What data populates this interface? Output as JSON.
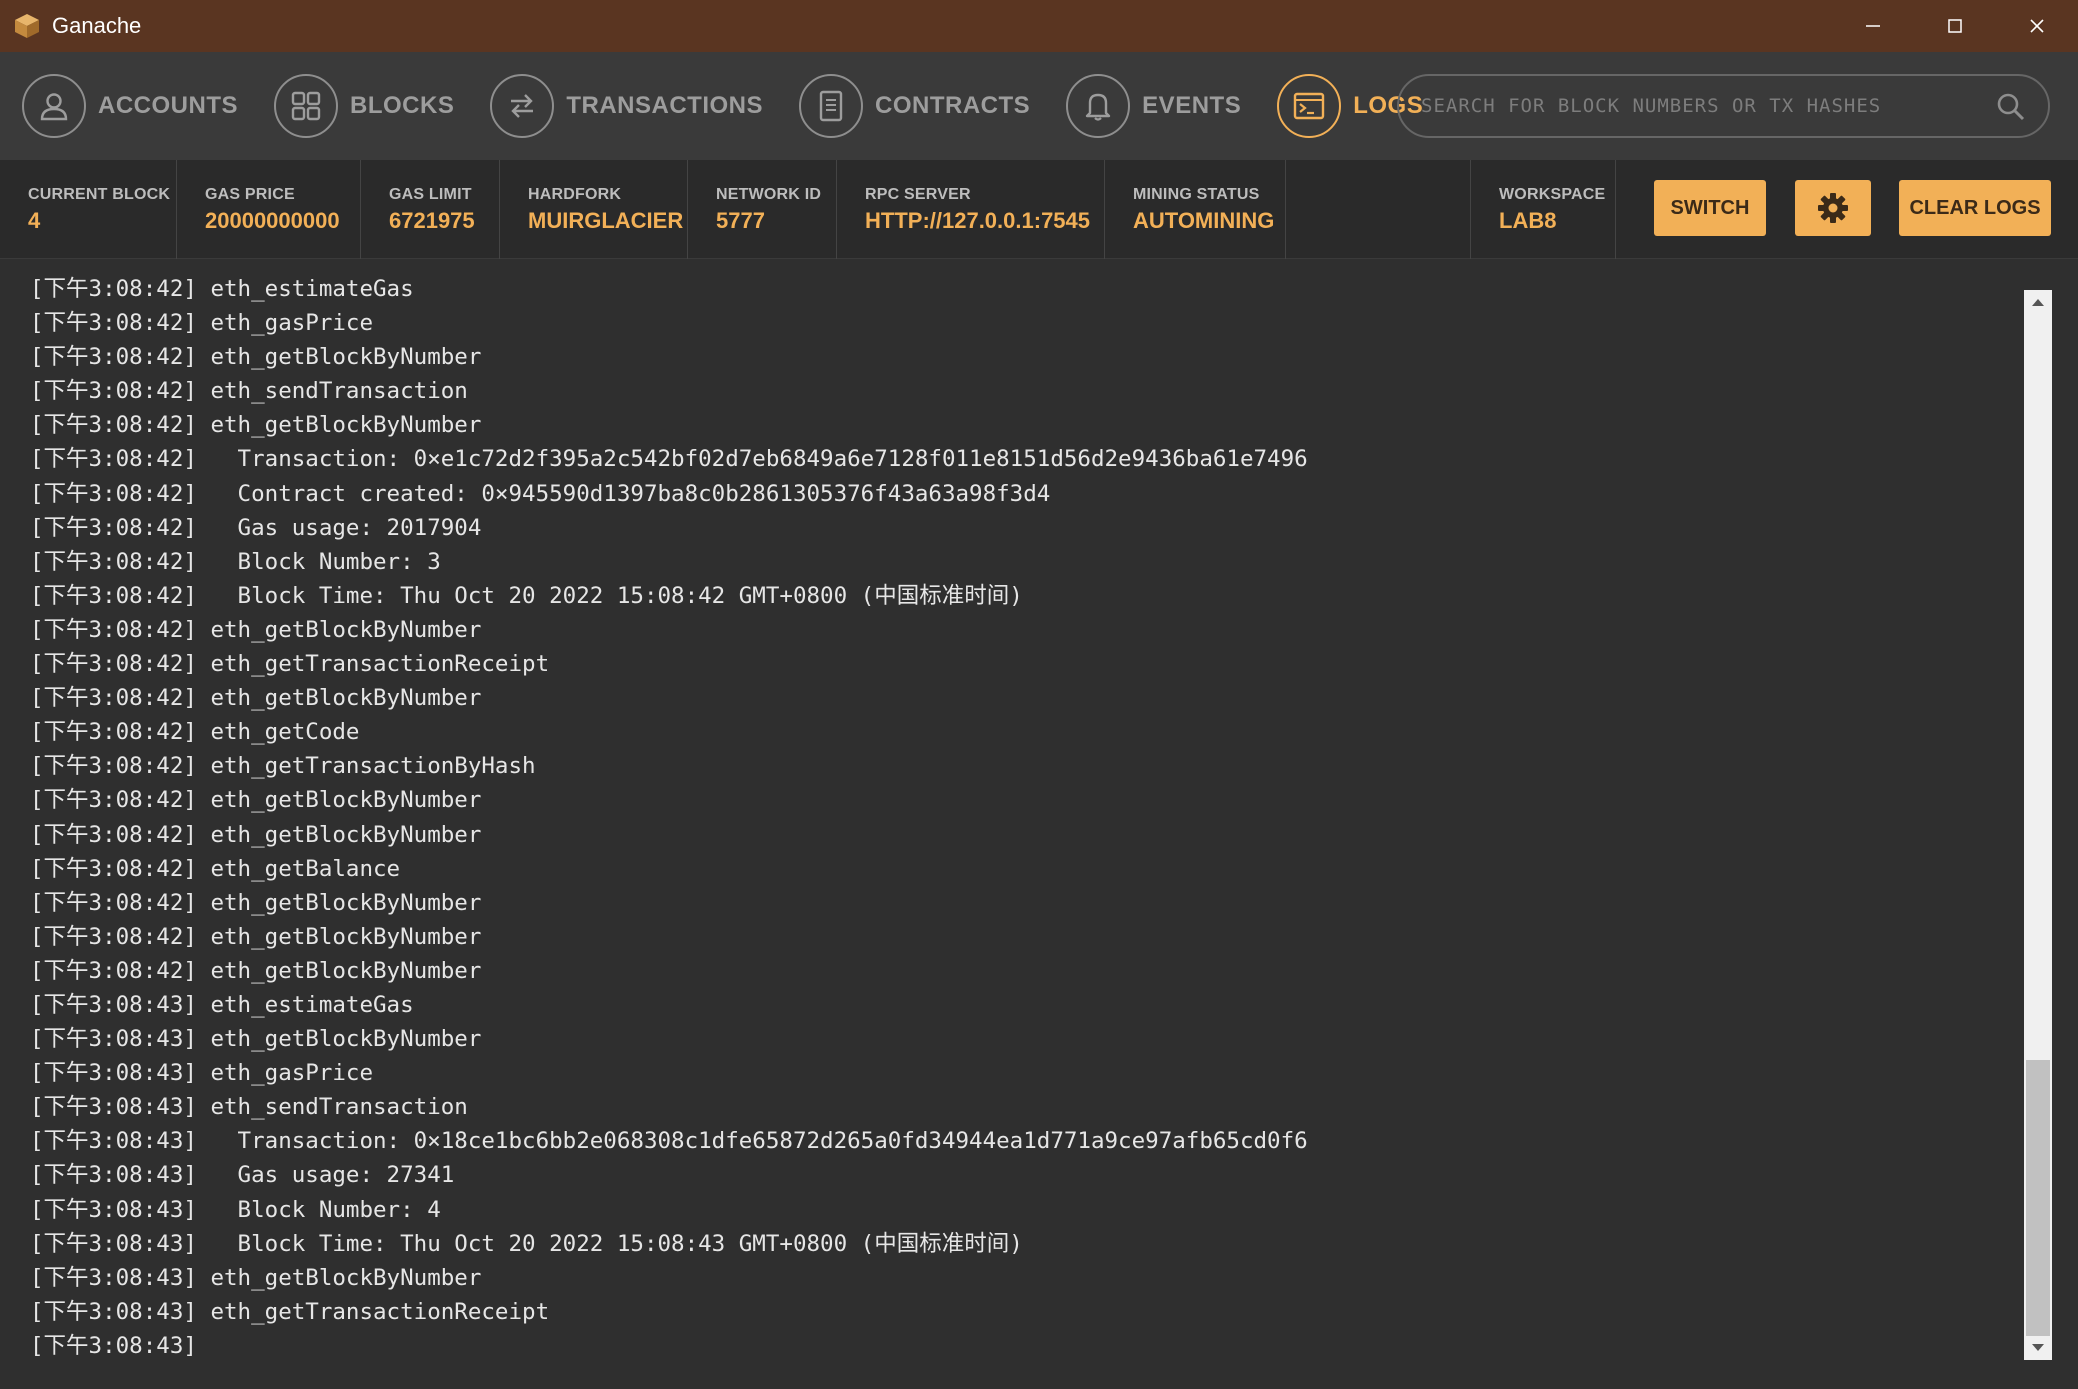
{
  "window": {
    "title": "Ganache",
    "controls": [
      "minimize-icon",
      "maximize-icon",
      "close-icon"
    ]
  },
  "nav": {
    "items": [
      {
        "label": "ACCOUNTS",
        "icon": "user-icon"
      },
      {
        "label": "BLOCKS",
        "icon": "grid-icon"
      },
      {
        "label": "TRANSACTIONS",
        "icon": "swap-arrows-icon"
      },
      {
        "label": "CONTRACTS",
        "icon": "document-icon"
      },
      {
        "label": "EVENTS",
        "icon": "bell-icon"
      },
      {
        "label": "LOGS",
        "icon": "terminal-icon"
      }
    ],
    "active": "LOGS",
    "search_placeholder": "SEARCH FOR BLOCK NUMBERS OR TX HASHES"
  },
  "status": {
    "current_block_label": "CURRENT BLOCK",
    "current_block": "4",
    "gas_price_label": "GAS PRICE",
    "gas_price": "20000000000",
    "gas_limit_label": "GAS LIMIT",
    "gas_limit": "6721975",
    "hardfork_label": "HARDFORK",
    "hardfork": "MUIRGLACIER",
    "network_id_label": "NETWORK ID",
    "network_id": "5777",
    "rpc_server_label": "RPC SERVER",
    "rpc_server": "HTTP://127.0.0.1:7545",
    "mining_status_label": "MINING STATUS",
    "mining_status": "AUTOMINING",
    "workspace_label": "WORKSPACE",
    "workspace": "LAB8"
  },
  "buttons": {
    "switch": "SWITCH",
    "settings_icon": "gear-icon",
    "clear_logs": "CLEAR LOGS"
  },
  "colors": {
    "accent": "#f2b057",
    "titlebar": "#5a3521",
    "navbar": "#3a3a3a",
    "background": "#2f2f2f"
  },
  "logs": [
    "[下午3:08:42] eth_estimateGas",
    "[下午3:08:42] eth_gasPrice",
    "[下午3:08:42] eth_getBlockByNumber",
    "[下午3:08:42] eth_sendTransaction",
    "[下午3:08:42] eth_getBlockByNumber",
    "[下午3:08:42]   Transaction: 0×e1c72d2f395a2c542bf02d7eb6849a6e7128f011e8151d56d2e9436ba61e7496",
    "[下午3:08:42]   Contract created: 0×945590d1397ba8c0b2861305376f43a63a98f3d4",
    "[下午3:08:42]   Gas usage: 2017904",
    "[下午3:08:42]   Block Number: 3",
    "[下午3:08:42]   Block Time: Thu Oct 20 2022 15:08:42 GMT+0800 (中国标准时间)",
    "[下午3:08:42] eth_getBlockByNumber",
    "[下午3:08:42] eth_getTransactionReceipt",
    "[下午3:08:42] eth_getBlockByNumber",
    "[下午3:08:42] eth_getCode",
    "[下午3:08:42] eth_getTransactionByHash",
    "[下午3:08:42] eth_getBlockByNumber",
    "[下午3:08:42] eth_getBlockByNumber",
    "[下午3:08:42] eth_getBalance",
    "[下午3:08:42] eth_getBlockByNumber",
    "[下午3:08:42] eth_getBlockByNumber",
    "[下午3:08:42] eth_getBlockByNumber",
    "[下午3:08:43] eth_estimateGas",
    "[下午3:08:43] eth_getBlockByNumber",
    "[下午3:08:43] eth_gasPrice",
    "[下午3:08:43] eth_sendTransaction",
    "[下午3:08:43]   Transaction: 0×18ce1bc6bb2e068308c1dfe65872d265a0fd34944ea1d771a9ce97afb65cd0f6",
    "[下午3:08:43]   Gas usage: 27341",
    "[下午3:08:43]   Block Number: 4",
    "[下午3:08:43]   Block Time: Thu Oct 20 2022 15:08:43 GMT+0800 (中国标准时间)",
    "[下午3:08:43] eth_getBlockByNumber",
    "[下午3:08:43] eth_getTransactionReceipt",
    "[下午3:08:43]"
  ]
}
